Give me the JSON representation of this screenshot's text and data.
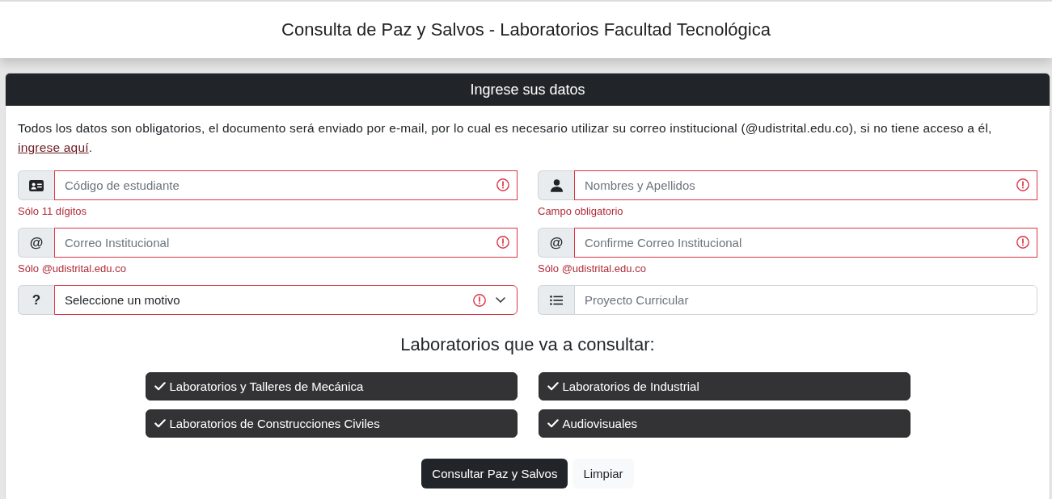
{
  "header": {
    "title": "Consulta de Paz y Salvos - Laboratorios Facultad Tecnológica"
  },
  "card": {
    "title": "Ingrese sus datos",
    "notice": {
      "text": "Todos los datos son obligatorios, el documento será enviado por e-mail, por lo cual es necesario utilizar su correo institucional (@udistrital.edu.co), si no tiene acceso a él, ",
      "link": "ingrese aquí",
      "end": "."
    },
    "fields": [
      {
        "kind": "text",
        "addon": {
          "kind": "id-card"
        },
        "placeholder": "Código de estudiante",
        "invalid": true,
        "error": "Sólo 11 dígitos"
      },
      {
        "kind": "text",
        "addon": {
          "kind": "person"
        },
        "placeholder": "Nombres y Apellidos",
        "invalid": true,
        "error": "Campo obligatorio"
      },
      {
        "kind": "text",
        "addon": {
          "kind": "char",
          "text": "@"
        },
        "placeholder": "Correo Institucional",
        "invalid": true,
        "error": "Sólo @udistrital.edu.co"
      },
      {
        "kind": "text",
        "addon": {
          "kind": "char",
          "text": "@"
        },
        "placeholder": "Confirme Correo Institucional",
        "invalid": true,
        "error": "Sólo @udistrital.edu.co"
      },
      {
        "kind": "select",
        "addon": {
          "kind": "char",
          "text": "?"
        },
        "value": "Seleccione un motivo",
        "invalid": true
      },
      {
        "kind": "text",
        "addon": {
          "kind": "list"
        },
        "placeholder": "Proyecto Curricular",
        "invalid": false
      }
    ],
    "labs": {
      "heading": "Laboratorios que va a consultar:",
      "items": [
        {
          "label": "Laboratorios y Talleres de Mecánica",
          "checked": true
        },
        {
          "label": "Laboratorios de Industrial",
          "checked": true
        },
        {
          "label": "Laboratorios de Construcciones Civiles",
          "checked": true
        },
        {
          "label": "Audiovisuales",
          "checked": true
        }
      ]
    },
    "buttons": [
      {
        "kind": "primary",
        "label": "Consultar Paz y Salvos"
      },
      {
        "kind": "light",
        "label": "Limpiar"
      }
    ]
  }
}
